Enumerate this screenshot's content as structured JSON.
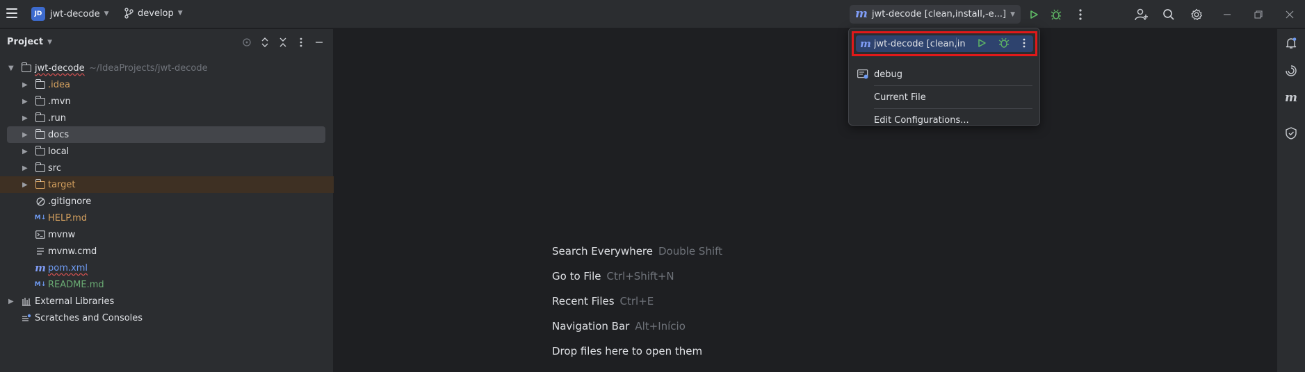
{
  "titlebar": {
    "project_badge": "JD",
    "project_name": "jwt-decode",
    "branch": "develop",
    "run_config": "jwt-decode [clean,install,-e...]"
  },
  "sidebar": {
    "title": "Project",
    "root": {
      "name": "jwt-decode",
      "path": "~/IdeaProjects/jwt-decode"
    },
    "items": [
      {
        "label": ".idea",
        "color": "#d5a15f"
      },
      {
        "label": ".mvn",
        "color": "#dfe1e5"
      },
      {
        "label": ".run",
        "color": "#dfe1e5"
      },
      {
        "label": "docs",
        "color": "#dfe1e5"
      },
      {
        "label": "local",
        "color": "#dfe1e5"
      },
      {
        "label": "src",
        "color": "#dfe1e5"
      },
      {
        "label": "target",
        "color": "#d5a15f"
      },
      {
        "label": ".gitignore",
        "color": "#dfe1e5"
      },
      {
        "label": "HELP.md",
        "color": "#d5a15f"
      },
      {
        "label": "mvnw",
        "color": "#dfe1e5"
      },
      {
        "label": "mvnw.cmd",
        "color": "#dfe1e5"
      },
      {
        "label": "pom.xml",
        "color": "#6f9bf2"
      },
      {
        "label": "README.md",
        "color": "#6aab73"
      },
      {
        "label": "External Libraries",
        "color": "#dfe1e5"
      },
      {
        "label": "Scratches and Consoles",
        "color": "#dfe1e5"
      }
    ]
  },
  "editor": {
    "hints": [
      {
        "action": "Search Everywhere",
        "shortcut": "Double Shift"
      },
      {
        "action": "Go to File",
        "shortcut": "Ctrl+Shift+N"
      },
      {
        "action": "Recent Files",
        "shortcut": "Ctrl+E"
      },
      {
        "action": "Navigation Bar",
        "shortcut": "Alt+Início"
      },
      {
        "action": "Drop files here to open them",
        "shortcut": ""
      }
    ]
  },
  "dropdown": {
    "selected": "jwt-decode [clean,in",
    "items": [
      "debug",
      "Current File",
      "Edit Configurations..."
    ]
  },
  "icons": {
    "m_glyph": "m"
  }
}
